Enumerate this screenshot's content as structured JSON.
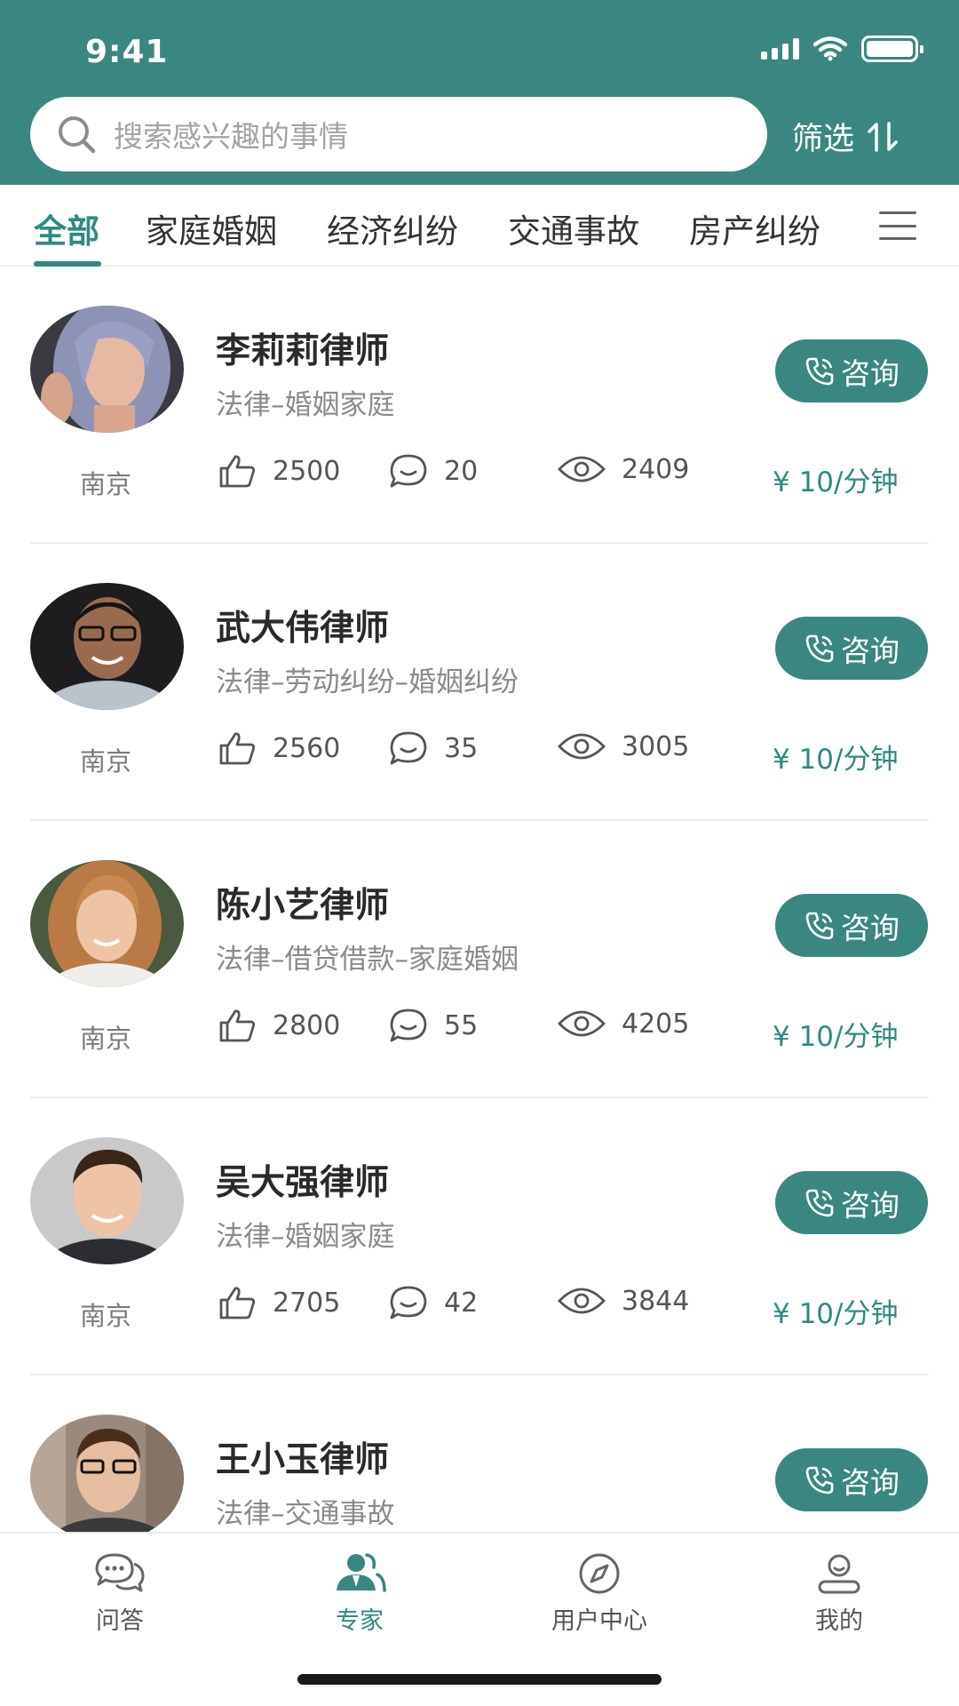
{
  "status_bar": {
    "time": "9:41"
  },
  "search": {
    "placeholder": "搜索感兴趣的事情"
  },
  "filter": {
    "label": "筛选"
  },
  "tabs": [
    {
      "label": "全部",
      "active": true
    },
    {
      "label": "家庭婚姻"
    },
    {
      "label": "经济纠纷"
    },
    {
      "label": "交通事故"
    },
    {
      "label": "房产纠纷"
    }
  ],
  "lawyers": [
    {
      "name": "李莉莉律师",
      "specialty": "法律–婚姻家庭",
      "city": "南京",
      "likes": "2500",
      "comments": "20",
      "views": "2409",
      "price": "¥ 10/分钟",
      "consult_label": "咨询"
    },
    {
      "name": "武大伟律师",
      "specialty": "法律–劳动纠纷–婚姻纠纷",
      "city": "南京",
      "likes": "2560",
      "comments": "35",
      "views": "3005",
      "price": "¥ 10/分钟",
      "consult_label": "咨询"
    },
    {
      "name": "陈小艺律师",
      "specialty": "法律–借贷借款–家庭婚姻",
      "city": "南京",
      "likes": "2800",
      "comments": "55",
      "views": "4205",
      "price": "¥ 10/分钟",
      "consult_label": "咨询"
    },
    {
      "name": "吴大强律师",
      "specialty": "法律–婚姻家庭",
      "city": "南京",
      "likes": "2705",
      "comments": "42",
      "views": "3844",
      "price": "¥ 10/分钟",
      "consult_label": "咨询"
    },
    {
      "name": "王小玉律师",
      "specialty": "法律–交通事故",
      "consult_label": "咨询"
    }
  ],
  "bottom_nav": [
    {
      "label": "问答",
      "icon": "chat-bubbles-icon"
    },
    {
      "label": "专家",
      "icon": "experts-icon",
      "active": true
    },
    {
      "label": "用户中心",
      "icon": "compass-icon"
    },
    {
      "label": "我的",
      "icon": "profile-icon"
    }
  ],
  "colors": {
    "brand": "#3a8781",
    "accent_text": "#2f8a82",
    "muted": "#8a8a8a"
  }
}
